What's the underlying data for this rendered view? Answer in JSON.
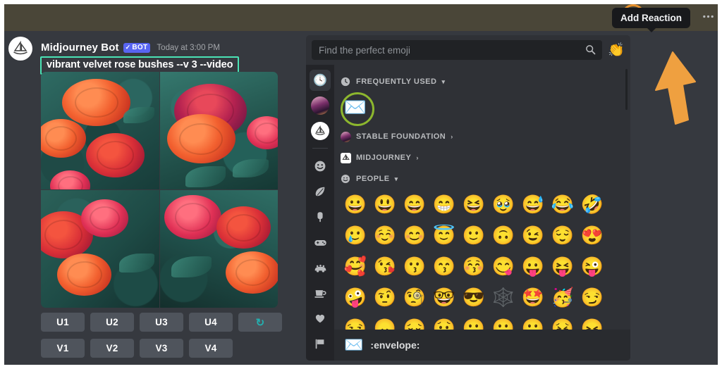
{
  "tooltip": {
    "label": "Add Reaction"
  },
  "message": {
    "author": "Midjourney Bot",
    "bot_badge": "BOT",
    "bot_check": "✓",
    "timestamp": "Today at 3:00 PM",
    "prompt": "vibrant velvet rose bushes --v 3 --video",
    "avatar_name": "midjourney-sailboat-avatar",
    "highlight_color": "#4ae3b5"
  },
  "action_bar": {
    "add_reaction_label": "add-reaction-icon",
    "reply_label": "reply-icon",
    "thread_label": "thread-icon",
    "more_label": "more-options-icon",
    "highlight_color": "#e8912d"
  },
  "upscale_buttons": [
    {
      "label": "U1"
    },
    {
      "label": "U2"
    },
    {
      "label": "U3"
    },
    {
      "label": "U4"
    }
  ],
  "reroll_button": {
    "label": "↻",
    "color": "#23b0b0"
  },
  "variation_buttons": [
    {
      "label": "V1"
    },
    {
      "label": "V2"
    },
    {
      "label": "V3"
    },
    {
      "label": "V4"
    }
  ],
  "picker": {
    "search": {
      "placeholder": "Find the perfect emoji",
      "value": ""
    },
    "header_emoji": "👏",
    "rail": [
      {
        "name": "frequently-used",
        "glyph": "🕓",
        "active": true
      },
      {
        "name": "server-stable-foundation",
        "glyph": "",
        "active": false
      },
      {
        "name": "server-midjourney",
        "glyph": "⛵",
        "active": false
      },
      {
        "name": "people",
        "glyph": "😃",
        "active": false
      },
      {
        "name": "nature",
        "glyph": "🍃",
        "active": false
      },
      {
        "name": "food",
        "glyph": "🍧",
        "active": false
      },
      {
        "name": "activities",
        "glyph": "🎮",
        "active": false
      },
      {
        "name": "travel",
        "glyph": "🚙",
        "active": false
      },
      {
        "name": "objects",
        "glyph": "☕",
        "active": false
      },
      {
        "name": "symbols",
        "glyph": "❤",
        "active": false
      },
      {
        "name": "flags",
        "glyph": "🏳",
        "active": false
      }
    ],
    "categories": [
      {
        "name": "frequently-used",
        "label": "FREQUENTLY USED",
        "chevron": "▾",
        "icon": "clock-icon"
      },
      {
        "name": "stable-foundation",
        "label": "STABLE FOUNDATION",
        "chevron": "›",
        "icon": "server-icon"
      },
      {
        "name": "midjourney",
        "label": "MIDJOURNEY",
        "chevron": "›",
        "icon": "server-icon"
      },
      {
        "name": "people",
        "label": "PEOPLE",
        "chevron": "▾",
        "icon": "smiley-icon"
      }
    ],
    "frequently_used": [
      {
        "glyph": "✉️",
        "name": "envelope",
        "highlighted": true
      }
    ],
    "people_rows": [
      [
        "😀",
        "😃",
        "😄",
        "😁",
        "😆",
        "🥹",
        "😅",
        "😂",
        "🤣"
      ],
      [
        "🥲",
        "☺️",
        "😊",
        "😇",
        "🙂",
        "🙃",
        "😉",
        "😌",
        "😍"
      ],
      [
        "🥰",
        "😘",
        "😗",
        "😙",
        "😚",
        "😋",
        "😛",
        "😝",
        "😜"
      ],
      [
        "🤪",
        "🤨",
        "🧐",
        "🤓",
        "😎",
        "🕸️",
        "🤩",
        "🥳",
        "😏"
      ],
      [
        "😒",
        "😞",
        "😔",
        "😟",
        "😕",
        "🙁",
        "☹️",
        "😣",
        "😖"
      ]
    ],
    "footer": {
      "emoji": "✉️",
      "name": ":envelope:"
    },
    "highlight_color": "#8db72e"
  }
}
